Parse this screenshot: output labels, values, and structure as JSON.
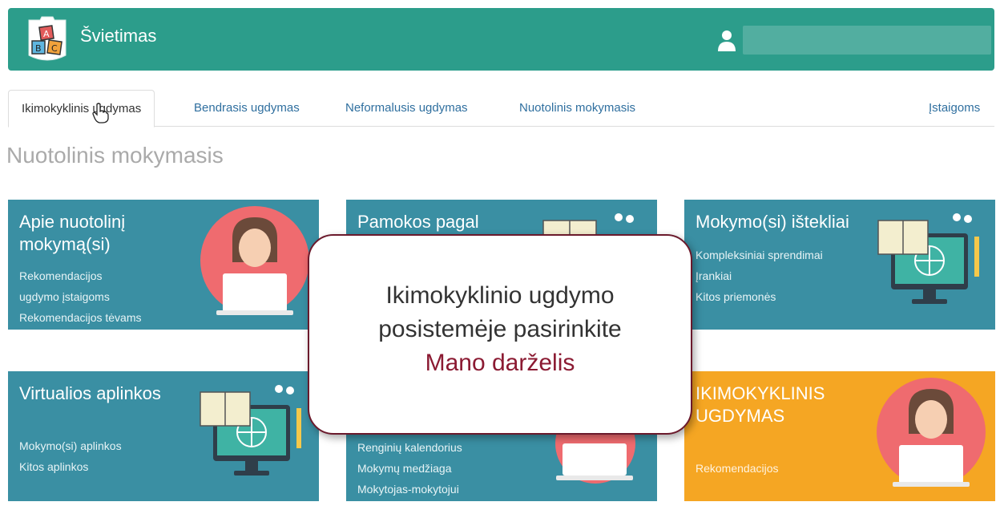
{
  "header": {
    "brand": "Švietimas",
    "colors": {
      "header_bg": "#2c9d8b",
      "card_bg": "#3a8fa3",
      "card_orange": "#f5a623",
      "modal_border": "#6b1a2c",
      "highlight": "#8b1a32"
    }
  },
  "tabs": [
    {
      "label": "Ikimokyklinis ugdymas"
    },
    {
      "label": "Bendrasis ugdymas"
    },
    {
      "label": "Neformalusis ugdymas"
    },
    {
      "label": "Nuotolinis mokymasis"
    },
    {
      "label": "Įstaigoms"
    }
  ],
  "page_title": "Nuotolinis mokymasis",
  "cards": [
    {
      "title": "Apie nuotolinį mokymą(si)",
      "links": [
        "Rekomendacijos",
        "ugdymo įstaigoms",
        "Rekomendacijos tėvams"
      ],
      "illustration": "teacher-laptop-icon"
    },
    {
      "title": "Pamokos pagal",
      "links": [],
      "illustration": "book-monitor-icon"
    },
    {
      "title": "Mokymo(si) ištekliai",
      "links": [
        "Kompleksiniai sprendimai",
        "Įrankiai",
        "Kitos priemonės"
      ],
      "illustration": "book-monitor-icon"
    },
    {
      "title": "Virtualios aplinkos",
      "links": [
        "Mokymo(si) aplinkos",
        "Kitos aplinkos"
      ],
      "illustration": "book-monitor-icon"
    },
    {
      "title": "",
      "links": [
        "Renginių kalendorius",
        "Mokymų medžiaga",
        "Mokytojas-mokytojui"
      ],
      "illustration": "teacher-laptop-icon"
    },
    {
      "title": "IKIMOKYKLINIS UGDYMAS",
      "links": [
        "Rekomendacijos"
      ],
      "illustration": "teacher-laptop-icon"
    }
  ],
  "modal": {
    "line1": "Ikimokyklinio ugdymo",
    "line2": "posistemėje pasirinkite",
    "highlight": "Mano darželis"
  }
}
